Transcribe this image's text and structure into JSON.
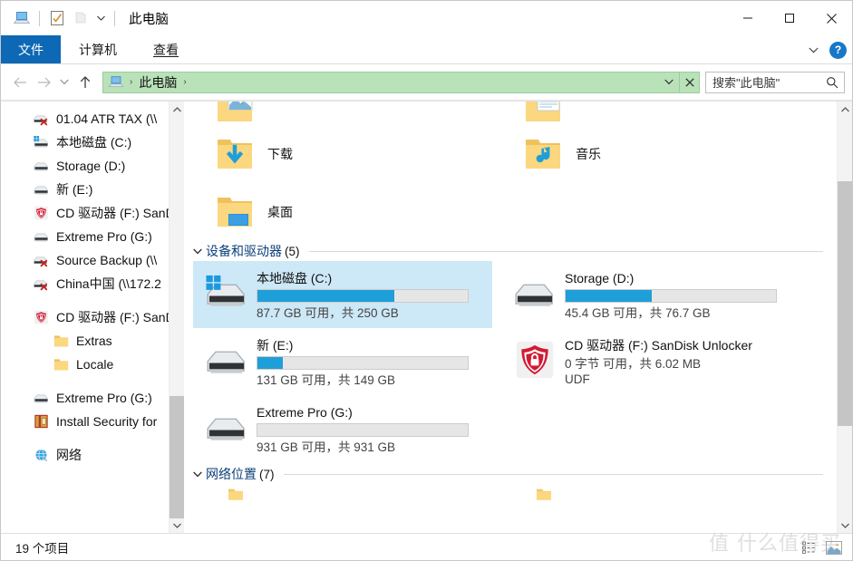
{
  "window": {
    "title": "此电脑",
    "quick_access": [
      {
        "name": "this-pc-icon",
        "label": "此电脑"
      },
      {
        "name": "properties-icon",
        "label": "属性"
      },
      {
        "name": "new-folder-icon",
        "label": "新建文件夹"
      },
      {
        "name": "customize-caret-icon",
        "label": "自定义快速访问工具栏"
      }
    ],
    "controls": {
      "minimize": "最小化",
      "maximize": "最大化",
      "close": "关闭"
    }
  },
  "ribbon": {
    "file_tab": "文件",
    "tabs": [
      {
        "label": "计算机",
        "active": false
      },
      {
        "label": "查看",
        "active": true
      }
    ],
    "collapse_label": "展开功能区",
    "help_label": "?"
  },
  "nav": {
    "back": "后退",
    "forward": "前进",
    "recent": "最近位置",
    "up": "上移到上一层",
    "breadcrumb": {
      "icon": "this-pc-icon",
      "items": [
        "此电脑"
      ],
      "separator": "›",
      "trailing_separator": "›"
    },
    "address_dropdown": "历史记录",
    "address_refresh": "刷新"
  },
  "search": {
    "placeholder": "搜索\"此电脑\"",
    "icon": "search-icon"
  },
  "sidebar": {
    "items": [
      {
        "label": "01.04 ATR TAX (\\\\",
        "icon": "network-drive-disconnected-icon",
        "indent": 1
      },
      {
        "label": "本地磁盘 (C:)",
        "icon": "windows-drive-icon",
        "indent": 1
      },
      {
        "label": "Storage (D:)",
        "icon": "drive-icon",
        "indent": 1
      },
      {
        "label": "新 (E:)",
        "icon": "drive-icon",
        "indent": 1
      },
      {
        "label": "CD 驱动器 (F:) SanD",
        "icon": "locked-drive-icon",
        "indent": 1
      },
      {
        "label": "Extreme Pro (G:)",
        "icon": "drive-icon",
        "indent": 1
      },
      {
        "label": "Source Backup (\\\\",
        "icon": "network-drive-disconnected-icon",
        "indent": 1
      },
      {
        "label": "China中国 (\\\\172.2",
        "icon": "network-drive-disconnected-icon",
        "indent": 1
      },
      {
        "label": "CD 驱动器 (F:) SanDi",
        "icon": "locked-drive-icon",
        "indent": 1,
        "gap_before": true
      },
      {
        "label": "Extras",
        "icon": "folder-icon",
        "indent": 2
      },
      {
        "label": "Locale",
        "icon": "folder-icon",
        "indent": 2
      },
      {
        "label": "Extreme Pro (G:)",
        "icon": "drive-icon",
        "indent": 1,
        "gap_before": true
      },
      {
        "label": "Install Security for",
        "icon": "archive-icon",
        "indent": 1
      },
      {
        "label": "网络",
        "icon": "network-icon",
        "indent": 1,
        "gap_before": true
      }
    ],
    "scrollbar": {
      "up": "向上滚动",
      "down": "向下滚动",
      "thumb": "滚动条滑块"
    }
  },
  "content": {
    "folders_top": [
      {
        "label": "",
        "icon": "pictures-folder-icon",
        "col": 0,
        "partial": true
      },
      {
        "label": "",
        "icon": "documents-folder-icon",
        "col": 1,
        "partial": true
      },
      {
        "label": "下载",
        "icon": "downloads-folder-icon",
        "col": 0
      },
      {
        "label": "音乐",
        "icon": "music-folder-icon",
        "col": 1
      },
      {
        "label": "桌面",
        "icon": "desktop-folder-icon",
        "col": 0
      }
    ],
    "devices_group": {
      "label": "设备和驱动器",
      "count": "(5)",
      "chevron": "chevron-down-icon"
    },
    "drives": [
      {
        "name": "本地磁盘 (C:)",
        "detail": "87.7 GB 可用，共 250 GB",
        "extra": "",
        "fill_percent": 65,
        "has_bar": true,
        "icon": "windows-drive-icon",
        "selected": true
      },
      {
        "name": "Storage (D:)",
        "detail": "45.4 GB 可用，共 76.7 GB",
        "extra": "",
        "fill_percent": 41,
        "has_bar": true,
        "icon": "drive-icon",
        "selected": false
      },
      {
        "name": "新 (E:)",
        "detail": "131 GB 可用，共 149 GB",
        "extra": "",
        "fill_percent": 12,
        "has_bar": true,
        "icon": "drive-icon",
        "selected": false
      },
      {
        "name": "CD 驱动器 (F:) SanDisk Unlocker",
        "detail": "0 字节 可用，共 6.02 MB",
        "extra": "UDF",
        "fill_percent": 0,
        "has_bar": false,
        "icon": "locked-drive-icon",
        "selected": false
      },
      {
        "name": "Extreme Pro (G:)",
        "detail": "931 GB 可用，共 931 GB",
        "extra": "",
        "fill_percent": 0,
        "has_bar": true,
        "icon": "drive-icon",
        "selected": false
      }
    ],
    "network_group": {
      "label": "网络位置",
      "count": "(7)",
      "chevron": "chevron-down-icon"
    },
    "scrollbar": {
      "up": "向上滚动",
      "down": "向下滚动",
      "thumb": "滚动条滑块"
    }
  },
  "statusbar": {
    "item_count": "19 个项目",
    "view_buttons": [
      {
        "name": "details-view-button",
        "label": "详细信息视图"
      },
      {
        "name": "large-icons-view-button",
        "label": "大图标视图"
      }
    ]
  },
  "watermark": {
    "text": "值 什么值得买"
  },
  "colors": {
    "file_tab_blue": "#0d68b5",
    "address_bar_green": "#b9e2b9",
    "progress_blue": "#1f9fd9",
    "selection_blue": "#cde8f7",
    "group_header_blue": "#0b3f7a",
    "scrollbar_thumb": "#c5c5c5"
  }
}
